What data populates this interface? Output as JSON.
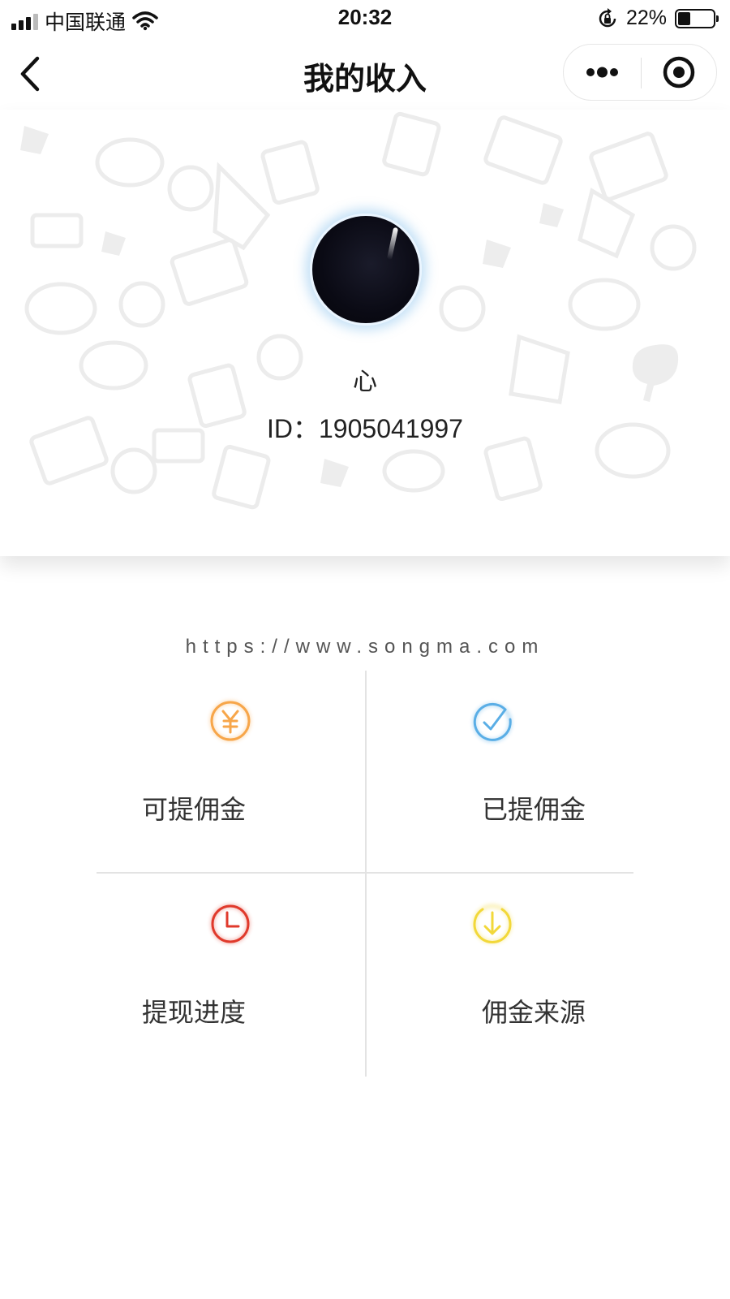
{
  "status_bar": {
    "carrier": "中国联通",
    "time": "20:32",
    "battery_percent": "22%",
    "battery_level": 0.22
  },
  "nav": {
    "title": "我的收入"
  },
  "profile": {
    "nickname": "心",
    "id_text": "ID：1905041997"
  },
  "site_url": "https://www.songma.com",
  "menu": [
    {
      "label": "可提佣金",
      "icon": "yen-coin-icon",
      "color": "#f7a64a"
    },
    {
      "label": "已提佣金",
      "icon": "check-circle-icon",
      "color": "#5aaee6"
    },
    {
      "label": "提现进度",
      "icon": "clock-icon",
      "color": "#e03a2c"
    },
    {
      "label": "佣金来源",
      "icon": "download-circle-icon",
      "color": "#f2d83a"
    }
  ]
}
